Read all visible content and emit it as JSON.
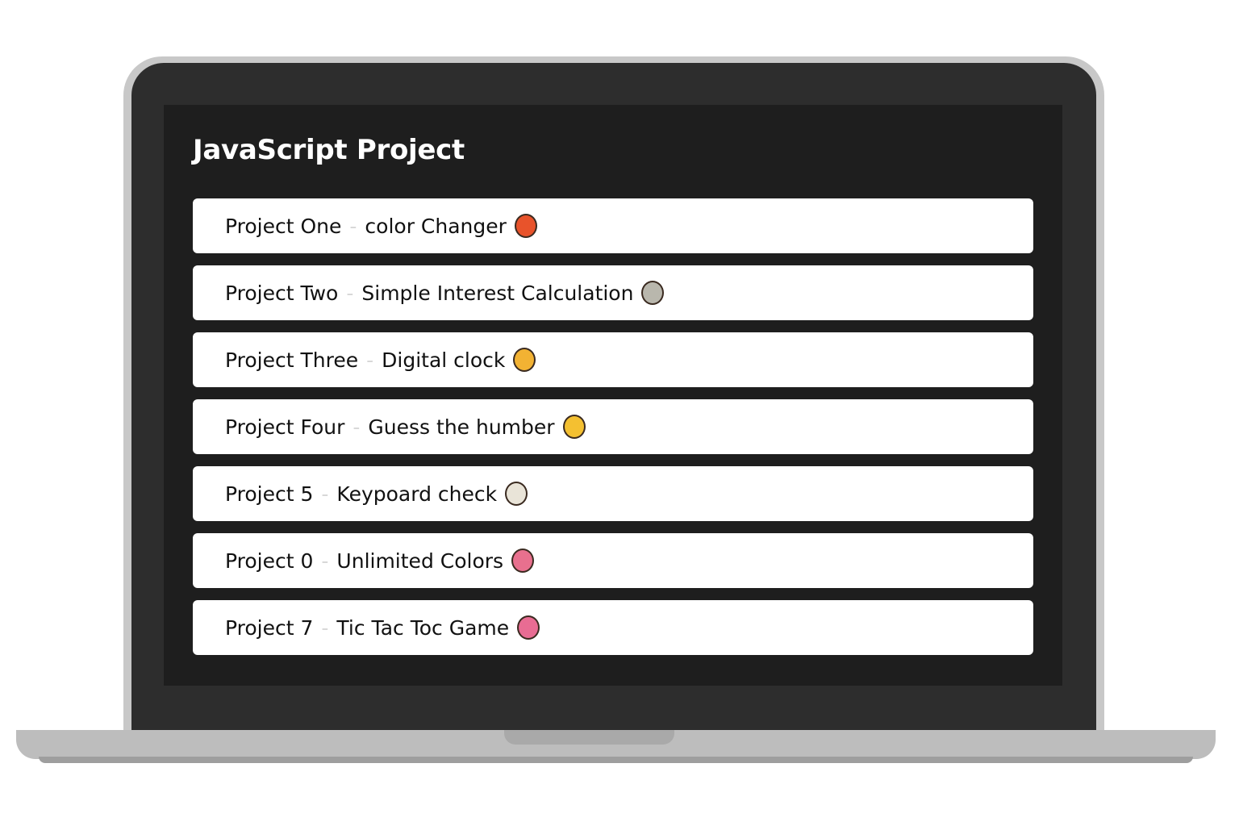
{
  "page": {
    "title": "JavaScript Project"
  },
  "projects": [
    {
      "name": "Project One",
      "separator": "-",
      "description": "color Changer",
      "icon": "red-blob-icon",
      "icon_color": "#e8532b"
    },
    {
      "name": "Project Two",
      "separator": "-",
      "description": "Simple Interest Calculation",
      "icon": "grey-rock-icon",
      "icon_color": "#b9b7ad"
    },
    {
      "name": "Project Three",
      "separator": "-",
      "description": "Digital clock",
      "icon": "sunglasses-face-icon",
      "icon_color": "#f2b233"
    },
    {
      "name": "Project Four",
      "separator": "-",
      "description": "Guess the humber",
      "icon": "yellow-face-icon",
      "icon_color": "#f4c031"
    },
    {
      "name": "Project 5",
      "separator": "-",
      "description": "Keypoard check",
      "icon": "bird-icon",
      "icon_color": "#e9e4d8"
    },
    {
      "name": "Project 0",
      "separator": "-",
      "description": "Unlimited Colors",
      "icon": "pink-ball-icon",
      "icon_color": "#e8708e"
    },
    {
      "name": "Project 7",
      "separator": "-",
      "description": "Tic Tac Toc Game",
      "icon": "pink-ball-icon",
      "icon_color": "#e86c93"
    }
  ],
  "colors": {
    "screen_background": "#1e1e1e",
    "bezel": "#2d2d2d",
    "laptop_silver": "#c8c8c8",
    "item_background": "#ffffff",
    "text": "#111111"
  }
}
